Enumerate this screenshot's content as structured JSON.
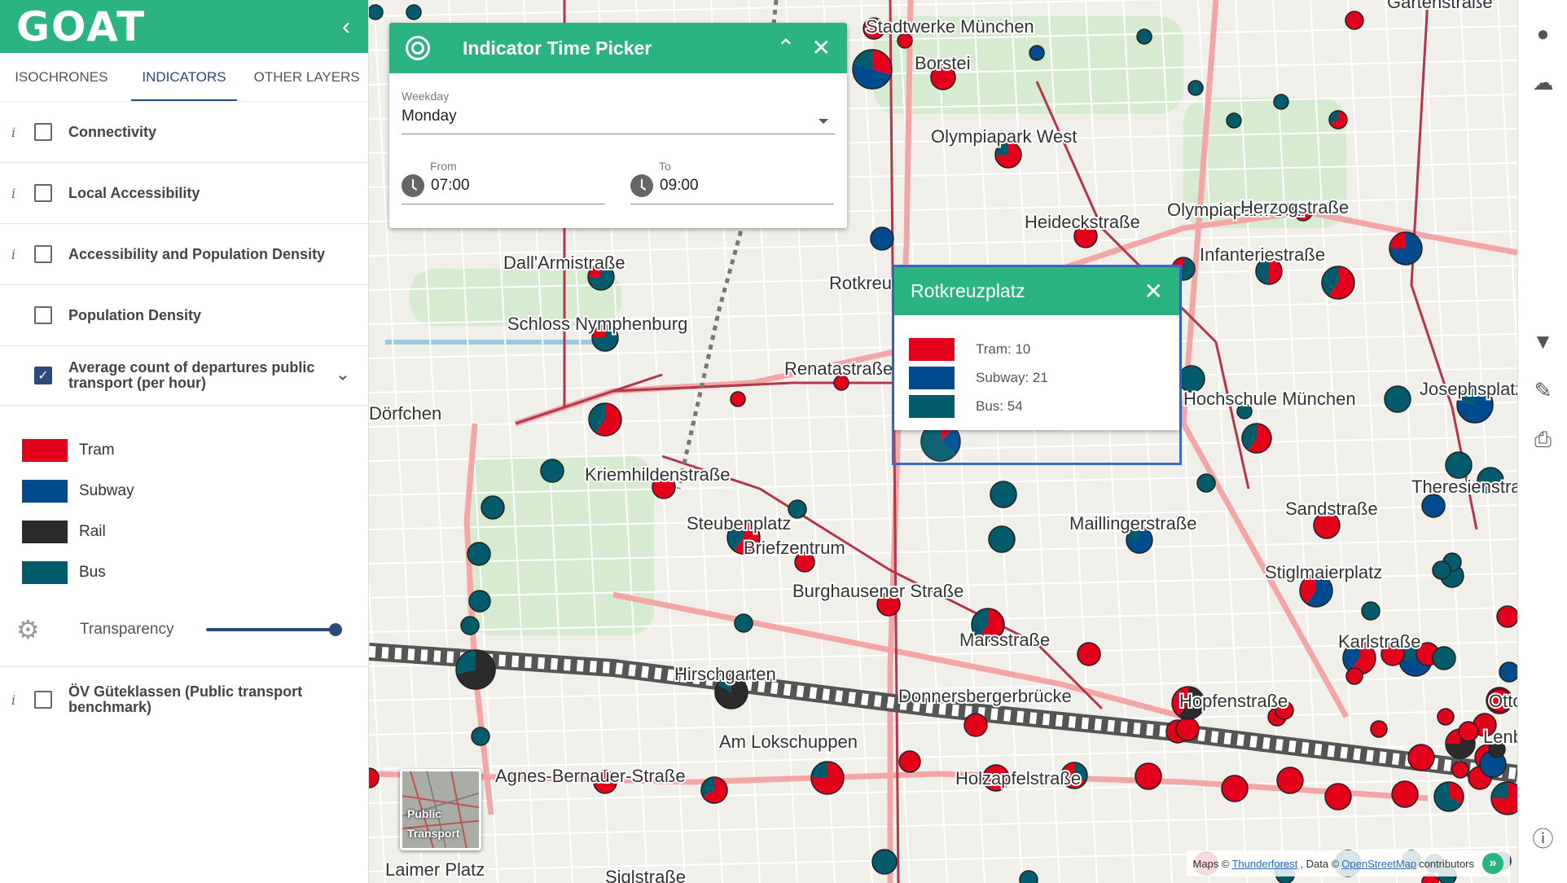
{
  "app": {
    "logo": "GOAT"
  },
  "tabs": [
    {
      "label": "ISOCHRONES"
    },
    {
      "label": "INDICATORS"
    },
    {
      "label": "OTHER LAYERS"
    }
  ],
  "layers": [
    {
      "label": "Connectivity",
      "info": "i",
      "checked": false
    },
    {
      "label": "Local Accessibility",
      "info": "i",
      "checked": false
    },
    {
      "label": "Accessibility and Population Density",
      "info": "i",
      "checked": false
    },
    {
      "label": "Population Density",
      "info": "",
      "checked": false
    },
    {
      "label": "Average count of departures public transport (per hour)",
      "info": "",
      "checked": true
    }
  ],
  "legend": [
    {
      "label": "Tram",
      "color": "#e2001a"
    },
    {
      "label": "Subway",
      "color": "#004b8d"
    },
    {
      "label": "Rail",
      "color": "#2b2b2b"
    },
    {
      "label": "Bus",
      "color": "#015b6b"
    }
  ],
  "transparency": {
    "label": "Transparency",
    "value": 1.0
  },
  "oev": {
    "label": "ÖV Güteklassen (Public transport benchmark)",
    "info": "i",
    "checked": false
  },
  "time_picker": {
    "title": "Indicator Time Picker",
    "weekday_label": "Weekday",
    "weekday_value": "Monday",
    "from_label": "From",
    "from_value": "07:00",
    "to_label": "To",
    "to_value": "09:00"
  },
  "popup": {
    "title": "Rotkreuzplatz",
    "rows": [
      {
        "text": "Tram: 10",
        "color": "#e2001a"
      },
      {
        "text": "Subway: 21",
        "color": "#004b8d"
      },
      {
        "text": "Bus: 54",
        "color": "#015b6b"
      }
    ]
  },
  "map_labels": [
    "Stadtwerke München",
    "Borstei",
    "Olympiapark West",
    "Heideckstraße",
    "Olympiapark Süd",
    "Herzogstraße",
    "Infanteriestraße",
    "Dall'Armistraße",
    "Schloss Nymphenburg",
    "Renatastraße",
    "Rotkreuzplatz",
    "Hochschule München",
    "Josephsplatz",
    "Kriemhildenstraße",
    "Steubenplatz",
    "Briefzentrum",
    "Maillingerstraße",
    "Theresienstraße",
    "Sandstraße",
    "Burghausener Straße",
    "Stiglmaierplatz",
    "Marsstraße",
    "Karlstraße",
    "Hirschgarten",
    "Donnersbergerbrücke",
    "Hopfenstraße",
    "Ottostraße",
    "Am Lokschuppen",
    "Agnes-Bernauer-Straße",
    "Holzapfelstraße",
    "Lenbachplatz",
    "Laimer Platz",
    "Siglstraße",
    "Gartenstraße",
    "Dörfchen"
  ],
  "baselayer": {
    "label": "Public Transport"
  },
  "attribution": {
    "prefix": "Maps ©",
    "link1": "Thunderforest",
    "mid": ", Data ©",
    "link2": "OpenStreetMap",
    "suffix": "contributors"
  }
}
